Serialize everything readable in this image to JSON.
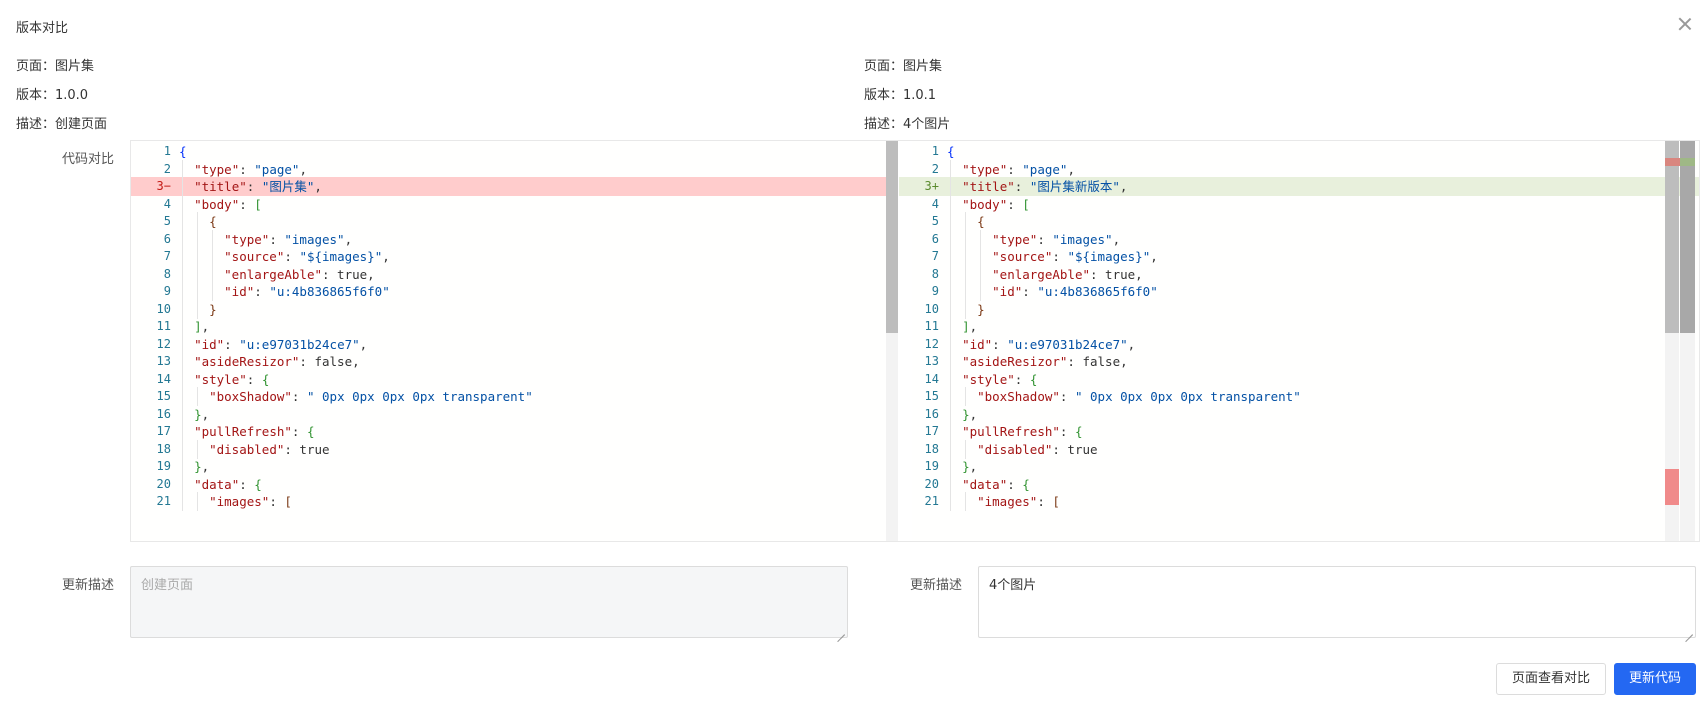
{
  "dialog": {
    "title": "版本对比",
    "close_icon": "close-icon"
  },
  "left_meta": {
    "page": "页面：图片集",
    "version": "版本：1.0.0",
    "desc": "描述：创建页面"
  },
  "right_meta": {
    "page": "页面：图片集",
    "version": "版本：1.0.1",
    "desc": "描述：4个图片"
  },
  "labels": {
    "code_compare": "代码对比",
    "update_desc_left": "更新描述",
    "update_desc_right": "更新描述"
  },
  "diff": {
    "left_lines": [
      {
        "n": "1",
        "marker": "",
        "text": "{"
      },
      {
        "n": "2",
        "marker": "",
        "text": "  \"type\": \"page\","
      },
      {
        "n": "3",
        "marker": "−",
        "text": "  \"title\": \"图片集\","
      },
      {
        "n": "4",
        "marker": "",
        "text": "  \"body\": ["
      },
      {
        "n": "5",
        "marker": "",
        "text": "    {"
      },
      {
        "n": "6",
        "marker": "",
        "text": "      \"type\": \"images\","
      },
      {
        "n": "7",
        "marker": "",
        "text": "      \"source\": \"${images}\","
      },
      {
        "n": "8",
        "marker": "",
        "text": "      \"enlargeAble\": true,"
      },
      {
        "n": "9",
        "marker": "",
        "text": "      \"id\": \"u:4b836865f6f0\""
      },
      {
        "n": "10",
        "marker": "",
        "text": "    }"
      },
      {
        "n": "11",
        "marker": "",
        "text": "  ],"
      },
      {
        "n": "12",
        "marker": "",
        "text": "  \"id\": \"u:e97031b24ce7\","
      },
      {
        "n": "13",
        "marker": "",
        "text": "  \"asideResizor\": false,"
      },
      {
        "n": "14",
        "marker": "",
        "text": "  \"style\": {"
      },
      {
        "n": "15",
        "marker": "",
        "text": "    \"boxShadow\": \" 0px 0px 0px 0px transparent\""
      },
      {
        "n": "16",
        "marker": "",
        "text": "  },"
      },
      {
        "n": "17",
        "marker": "",
        "text": "  \"pullRefresh\": {"
      },
      {
        "n": "18",
        "marker": "",
        "text": "    \"disabled\": true"
      },
      {
        "n": "19",
        "marker": "",
        "text": "  },"
      },
      {
        "n": "20",
        "marker": "",
        "text": "  \"data\": {"
      },
      {
        "n": "21",
        "marker": "",
        "text": "    \"images\": ["
      }
    ],
    "right_lines": [
      {
        "n": "1",
        "marker": "",
        "text": "{"
      },
      {
        "n": "2",
        "marker": "",
        "text": "  \"type\": \"page\","
      },
      {
        "n": "3",
        "marker": "+",
        "text": "  \"title\": \"图片集新版本\","
      },
      {
        "n": "4",
        "marker": "",
        "text": "  \"body\": ["
      },
      {
        "n": "5",
        "marker": "",
        "text": "    {"
      },
      {
        "n": "6",
        "marker": "",
        "text": "      \"type\": \"images\","
      },
      {
        "n": "7",
        "marker": "",
        "text": "      \"source\": \"${images}\","
      },
      {
        "n": "8",
        "marker": "",
        "text": "      \"enlargeAble\": true,"
      },
      {
        "n": "9",
        "marker": "",
        "text": "      \"id\": \"u:4b836865f6f0\""
      },
      {
        "n": "10",
        "marker": "",
        "text": "    }"
      },
      {
        "n": "11",
        "marker": "",
        "text": "  ],"
      },
      {
        "n": "12",
        "marker": "",
        "text": "  \"id\": \"u:e97031b24ce7\","
      },
      {
        "n": "13",
        "marker": "",
        "text": "  \"asideResizor\": false,"
      },
      {
        "n": "14",
        "marker": "",
        "text": "  \"style\": {"
      },
      {
        "n": "15",
        "marker": "",
        "text": "    \"boxShadow\": \" 0px 0px 0px 0px transparent\""
      },
      {
        "n": "16",
        "marker": "",
        "text": "  },"
      },
      {
        "n": "17",
        "marker": "",
        "text": "  \"pullRefresh\": {"
      },
      {
        "n": "18",
        "marker": "",
        "text": "    \"disabled\": true"
      },
      {
        "n": "19",
        "marker": "",
        "text": "  },"
      },
      {
        "n": "20",
        "marker": "",
        "text": "  \"data\": {"
      },
      {
        "n": "21",
        "marker": "",
        "text": "    \"images\": ["
      }
    ]
  },
  "textareas": {
    "left_value": "创建页面",
    "right_value": "4个图片"
  },
  "buttons": {
    "view_compare": "页面查看对比",
    "update_code": "更新代码"
  },
  "colors": {
    "primary": "#2468f2",
    "diff_delete": "#ffcccc",
    "diff_add": "#e8f0dc"
  }
}
